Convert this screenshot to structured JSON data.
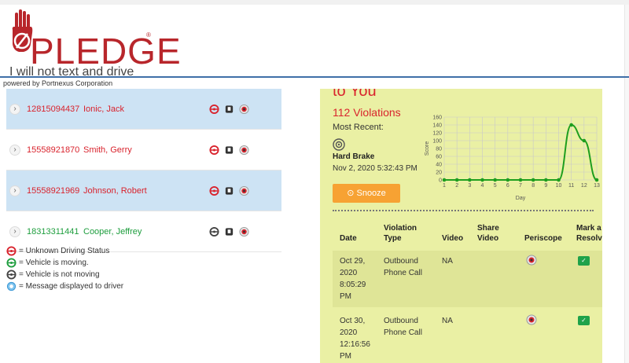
{
  "brand": {
    "logo_text": "PLEDGE",
    "logo_tagline": "I will not text and drive",
    "registered_mark": "®",
    "powered_by": "powered by Portnexus Corporation"
  },
  "drivers": [
    {
      "phone": "12815094437",
      "name": "Ionic, Jack",
      "status": "unknown",
      "selected": true
    },
    {
      "phone": "15558921870",
      "name": "Smith, Gerry",
      "status": "unknown",
      "selected": false
    },
    {
      "phone": "15558921969",
      "name": "Johnson, Robert",
      "status": "unknown",
      "selected": true
    },
    {
      "phone": "18313311441",
      "name": "Cooper, Jeffrey",
      "status": "not-moving",
      "selected": false
    }
  ],
  "legend": [
    {
      "icon": "steering-wheel-red-icon",
      "text": "= Unknown Driving Status"
    },
    {
      "icon": "steering-wheel-green-icon",
      "text": "= Vehicle is moving."
    },
    {
      "icon": "steering-wheel-grey-icon",
      "text": "= Vehicle is not moving"
    },
    {
      "icon": "message-bubble-icon",
      "text": "= Message displayed to driver"
    }
  ],
  "detail": {
    "title": "to You",
    "violations": "112 Violations",
    "most_recent_label": "Most Recent:",
    "event_type": "Hard Brake",
    "event_date": "Nov 2, 2020 5:32:43 PM",
    "snooze_label": "Snooze",
    "snooze_icon": "clock-icon"
  },
  "chart_data": {
    "type": "line",
    "xlabel": "Day",
    "ylabel": "Score",
    "x": [
      1,
      2,
      3,
      4,
      5,
      6,
      7,
      8,
      9,
      10,
      11,
      12,
      13
    ],
    "ylim": [
      0,
      160
    ],
    "yticks": [
      0,
      20,
      40,
      60,
      80,
      100,
      120,
      140,
      160
    ],
    "series": [
      {
        "values": [
          0,
          0,
          0,
          0,
          0,
          0,
          0,
          0,
          0,
          0,
          140,
          100,
          0
        ]
      }
    ],
    "grid": true,
    "color": "#1e9e1e"
  },
  "table": {
    "headers": {
      "date": "Date",
      "violation1": "Violation",
      "violation2": "Type",
      "video": "Video",
      "share1": "Share",
      "share2": "Video",
      "periscope": "Periscope",
      "mark1": "Mark a",
      "mark2": "Resolv"
    },
    "rows": [
      {
        "date": [
          "Oct 29,",
          "2020",
          "8:05:29",
          "PM"
        ],
        "type": [
          "Outbound",
          "Phone Call"
        ],
        "video": "NA"
      },
      {
        "date": [
          "Oct 30,",
          "2020",
          "12:16:56",
          "PM"
        ],
        "type": [
          "Outbound",
          "Phone Call"
        ],
        "video": "NA"
      }
    ]
  }
}
